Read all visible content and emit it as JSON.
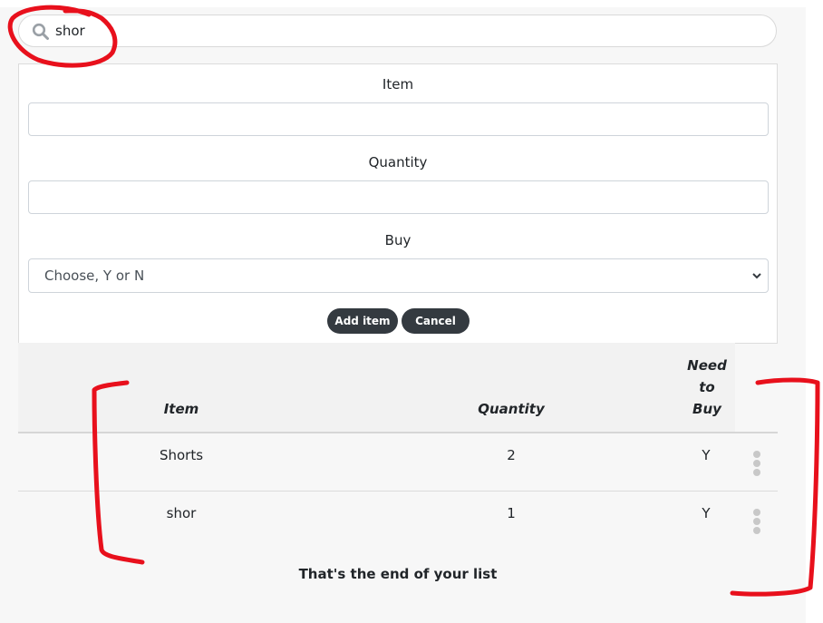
{
  "search": {
    "value": "shor",
    "icon": "search-icon"
  },
  "form": {
    "item_label": "Item",
    "quantity_label": "Quantity",
    "buy_label": "Buy",
    "item_value": "",
    "quantity_value": "",
    "buy_selected": "Choose, Y or N",
    "add_button": "Add item",
    "cancel_button": "Cancel"
  },
  "table": {
    "headers": {
      "item": "Item",
      "quantity": "Quantity",
      "need_to_buy": [
        "Need",
        "to",
        "Buy"
      ]
    },
    "rows": [
      {
        "item": "Shorts",
        "quantity": "2",
        "buy": "Y"
      },
      {
        "item": "shor",
        "quantity": "1",
        "buy": "Y"
      }
    ]
  },
  "footer": {
    "end_text": "That's the end of your list"
  },
  "colors": {
    "button_bg": "#343a40",
    "annotation": "#e8101c",
    "page_bg": "#f7f7f7"
  }
}
